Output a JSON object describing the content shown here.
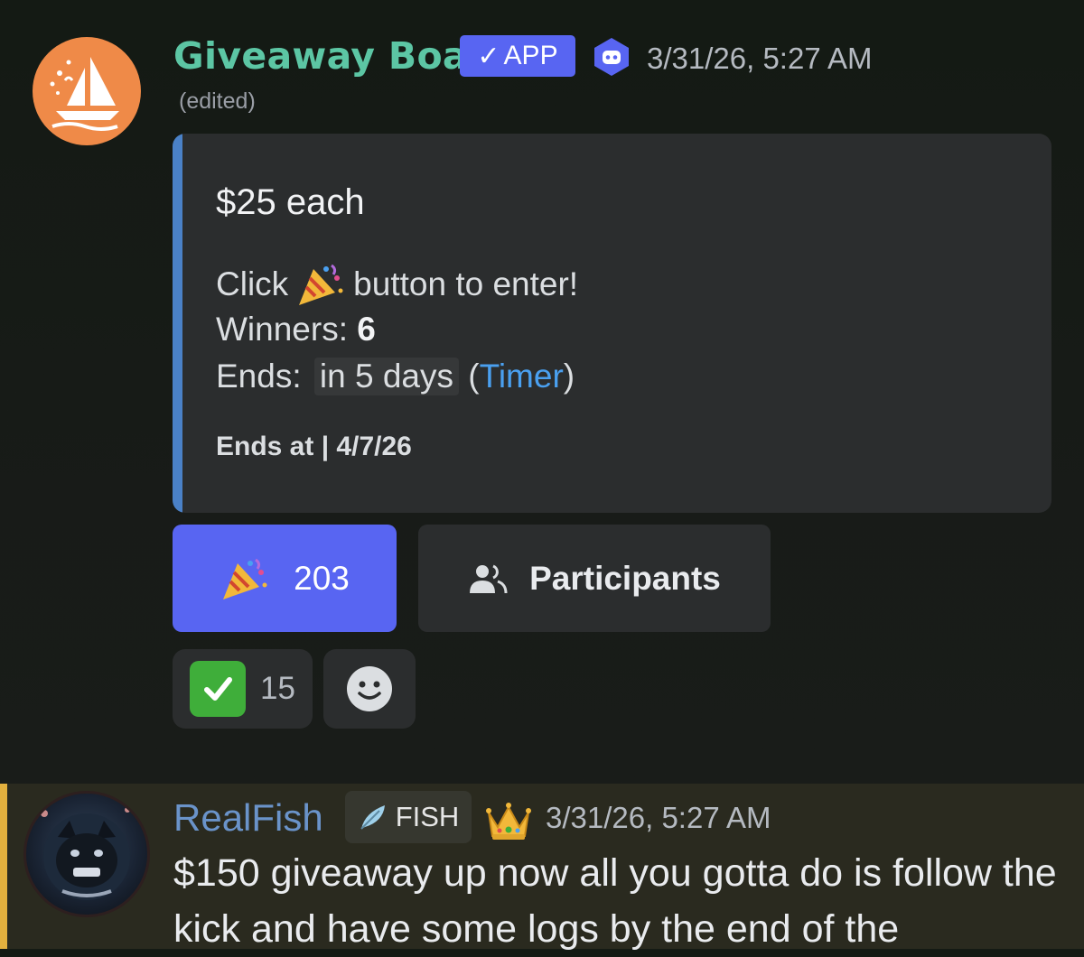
{
  "message1": {
    "username": "Giveaway Boat",
    "app_tag": "APP",
    "timestamp": "3/31/26, 5:27 AM",
    "edited": "(edited)",
    "embed": {
      "title": "$25 each",
      "click_prefix": "Click",
      "click_suffix": "button to enter!",
      "winners_label": "Winners: ",
      "winners_value": "6",
      "ends_label": "Ends: ",
      "ends_relative": "in 5 days",
      "timer_open": " (",
      "timer_link": "Timer",
      "timer_close": ")",
      "footer": "Ends at | 4/7/26",
      "accent_color": "#4a81c7"
    },
    "buttons": {
      "enter_count": "203",
      "participants_label": "Participants"
    },
    "reactions": [
      {
        "emoji": "check-mark-icon",
        "count": "15"
      }
    ]
  },
  "message2": {
    "username": "RealFish",
    "tag": "FISH",
    "timestamp": "3/31/26, 5:27 AM",
    "text": "$150 giveaway up now all you gotta do is follow the kick and have some logs by the end of the"
  },
  "colors": {
    "blurple": "#5865f2",
    "username1": "#5cc6a4",
    "username2": "#6a93c9",
    "highlight_bar": "#e2b03e"
  }
}
